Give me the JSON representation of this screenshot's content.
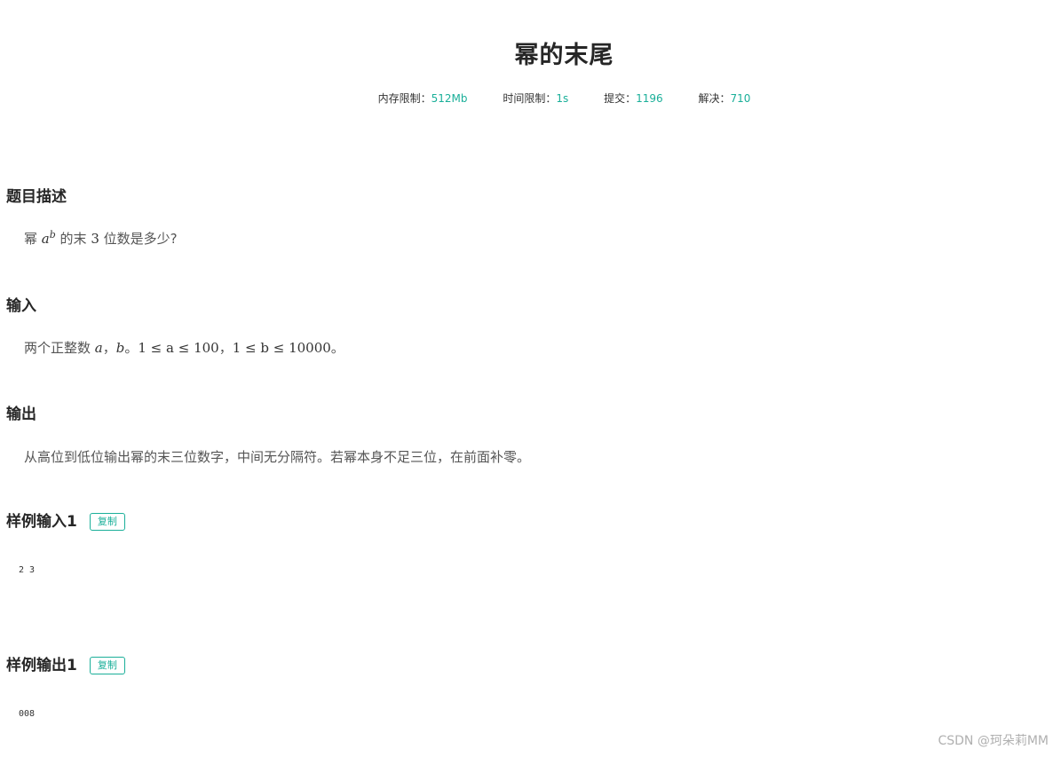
{
  "problem": {
    "title": "幂的末尾",
    "meta": {
      "memory_label": "内存限制：",
      "memory_value": "512Mb",
      "time_label": "时间限制：",
      "time_value": "1s",
      "submit_label": "提交：",
      "submit_value": "1196",
      "solved_label": "解决：",
      "solved_value": "710"
    },
    "description": {
      "heading": "题目描述",
      "text_prefix": "幂 ",
      "math_base": "a",
      "math_exp": "b",
      "text_mid": " 的末 ",
      "math_three": "3",
      "text_suffix": " 位数是多少?"
    },
    "input": {
      "heading": "输入",
      "text_prefix": "两个正整数 ",
      "var_a": "a",
      "sep": "，",
      "var_b": "b",
      "period": "。",
      "cond1": "1 ≤ a ≤ 100",
      "sep2": "，",
      "cond2": "1 ≤ b ≤ 10000",
      "end": "。"
    },
    "output": {
      "heading": "输出",
      "text": "从高位到低位输出幂的末三位数字，中间无分隔符。若幂本身不足三位，在前面补零。"
    },
    "sample_input": {
      "heading": "样例输入1",
      "copy_label": "复制",
      "content": "2 3"
    },
    "sample_output": {
      "heading": "样例输出1",
      "copy_label": "复制",
      "content": "008"
    }
  },
  "watermark": "CSDN @珂朵莉MM",
  "colors": {
    "accent": "#1aaf99"
  }
}
